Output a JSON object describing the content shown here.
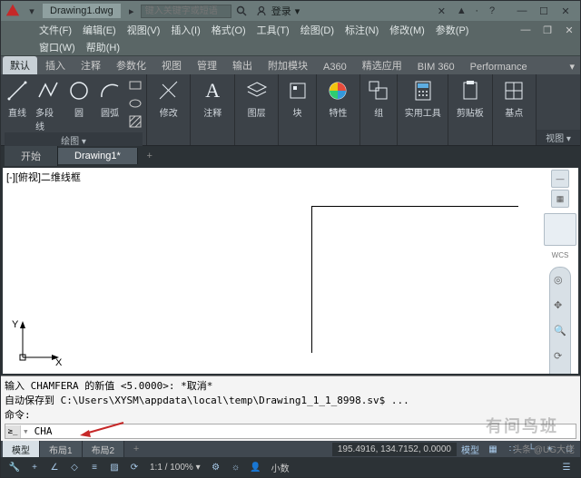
{
  "title": {
    "filename": "Drawing1.dwg",
    "search_placeholder": "键入关键字或短语",
    "login": "登录"
  },
  "menus": {
    "row1": [
      "文件(F)",
      "编辑(E)",
      "视图(V)",
      "插入(I)",
      "格式(O)",
      "工具(T)",
      "绘图(D)",
      "标注(N)",
      "修改(M)",
      "参数(P)"
    ],
    "row2": [
      "窗口(W)",
      "帮助(H)"
    ]
  },
  "ribbon": {
    "tabs": [
      "默认",
      "插入",
      "注释",
      "参数化",
      "视图",
      "管理",
      "输出",
      "附加模块",
      "A360",
      "精选应用",
      "BIM 360",
      "Performance"
    ],
    "expand": "▾",
    "panels": {
      "draw": {
        "title": "绘图 ▾",
        "line": "直线",
        "polyline": "多段线",
        "circle": "圆",
        "arc": "圆弧"
      },
      "modify": {
        "title": "修改"
      },
      "annot": {
        "title": "注释"
      },
      "layer": {
        "title": "图层"
      },
      "block": {
        "title": "块"
      },
      "prop": {
        "title": "特性"
      },
      "group": {
        "title": "组"
      },
      "util": {
        "title": "实用工具"
      },
      "clip": {
        "title": "剪贴板"
      },
      "base": {
        "title": "基点"
      },
      "view": {
        "title": "视图 ▾"
      }
    }
  },
  "filetabs": {
    "start": "开始",
    "drawing": "Drawing1*"
  },
  "canvas": {
    "viewport_label": "[-][俯视]二维线框",
    "ucs_y": "Y",
    "ucs_x": "X",
    "wcs": "WCS"
  },
  "cmd": {
    "line1": "输入 CHAMFERA 的新值 <5.0000>: *取消*",
    "line2": "自动保存到 C:\\Users\\XYSM\\appdata\\local\\temp\\Drawing1_1_1_8998.sv$ ...",
    "line3": "命令:",
    "input": "CHA"
  },
  "layouts": {
    "model": "模型",
    "l1": "布局1",
    "l2": "布局2"
  },
  "status": {
    "coords": "195.4916, 134.7152, 0.0000",
    "model_btn": "模型",
    "zoom": "1:1 / 100% ▾",
    "decimal": "小数"
  },
  "watermark": "有间鸟班",
  "credit": "头条 @UG大佬"
}
